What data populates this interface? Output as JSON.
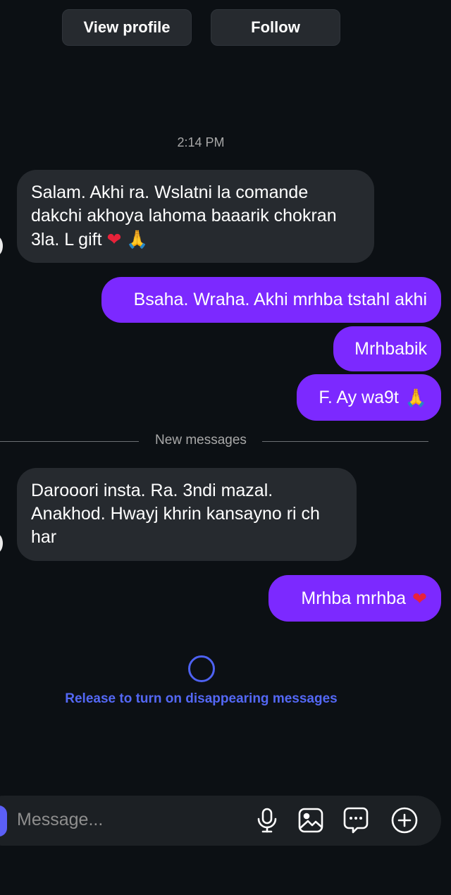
{
  "header": {
    "view_profile_label": "View profile",
    "follow_label": "Follow"
  },
  "conversation": {
    "timestamp": "2:14 PM",
    "messages": [
      {
        "direction": "incoming",
        "text": "Salam. Akhi  ra. Wslatni la comande dakchi akhoya lahoma baaarik chokran 3la. L gift",
        "emojis": [
          "heart",
          "folded-hands"
        ]
      },
      {
        "direction": "outgoing",
        "text": "Bsaha. Wraha. Akhi mrhba tstahl akhi"
      },
      {
        "direction": "outgoing",
        "text": "Mrhbabik"
      },
      {
        "direction": "outgoing",
        "text": "F. Ay wa9t",
        "emojis": [
          "folded-hands"
        ]
      },
      {
        "direction": "incoming",
        "text": "Darooori insta. Ra. 3ndi mazal. Anakhod. Hwayj khrin kansayno ri ch har"
      },
      {
        "direction": "outgoing",
        "text": "Mrhba mrhba",
        "emojis": [
          "heart"
        ]
      }
    ],
    "new_messages_label": "New messages",
    "release_hint": "Release to turn on disappearing messages"
  },
  "composer": {
    "placeholder": "Message...",
    "icons": [
      "microphone-icon",
      "image-icon",
      "sticker-icon",
      "add-icon"
    ]
  },
  "colors": {
    "background": "#0c1014",
    "incoming_bubble": "#262a2f",
    "outgoing_bubble": "#7c29ff",
    "accent_blue": "#5468f5"
  }
}
